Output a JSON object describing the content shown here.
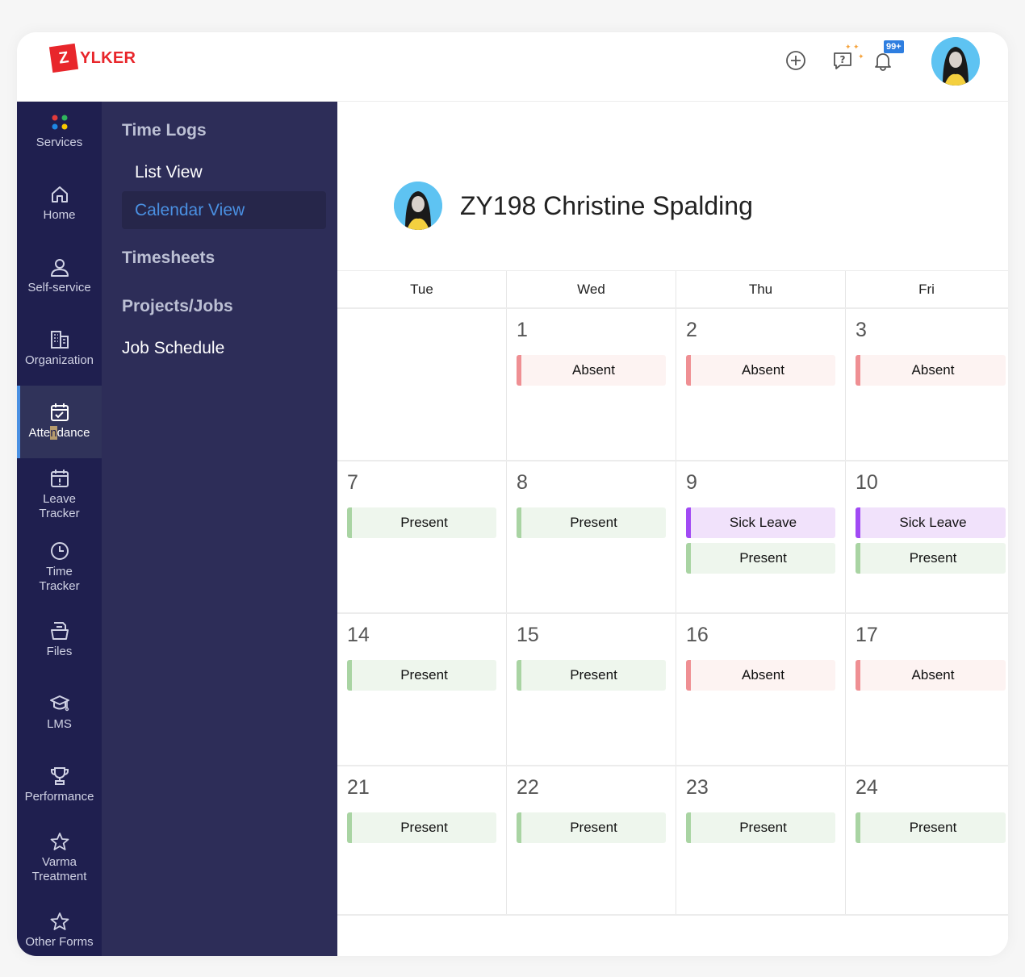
{
  "app": {
    "brand_letter": "Z",
    "brand_name": "YLKER",
    "accent": "#e8262b"
  },
  "header": {
    "icons": [
      "add-circle-icon",
      "help-chat-icon",
      "notification-bell-icon"
    ],
    "notification_badge": "99+"
  },
  "nav": {
    "items": [
      {
        "label": "Services",
        "icon": "services-dots-icon"
      },
      {
        "label": "Home",
        "icon": "home-icon"
      },
      {
        "label": "Self-service",
        "icon": "user-icon"
      },
      {
        "label": "Organization",
        "icon": "building-icon"
      },
      {
        "label_a": "Atte",
        "label_b": "n",
        "label_c": "dance",
        "icon": "calendar-check-icon",
        "active": true
      },
      {
        "label1": "Leave",
        "label2": "Tracker",
        "icon": "calendar-alert-icon"
      },
      {
        "label1": "Time",
        "label2": "Tracker",
        "icon": "clock-icon"
      },
      {
        "label": "Files",
        "icon": "folder-icon"
      },
      {
        "label": "LMS",
        "icon": "graduation-cap-icon"
      },
      {
        "label": "Performance",
        "icon": "trophy-icon"
      },
      {
        "label1": "Varma",
        "label2": "Treatment",
        "icon": "star-icon"
      },
      {
        "label": "Other Forms",
        "icon": "star-icon"
      }
    ]
  },
  "subnav": {
    "time_logs": "Time Logs",
    "list_view": "List View",
    "calendar_view": "Calendar View",
    "timesheets": "Timesheets",
    "projects_jobs": "Projects/Jobs",
    "job_schedule": "Job Schedule"
  },
  "employee": {
    "name": "ZY198 Christine Spalding"
  },
  "calendar": {
    "weekdays": [
      "Tue",
      "Wed",
      "Thu",
      "Fri"
    ],
    "weeks": [
      [
        {
          "day": "",
          "events": []
        },
        {
          "day": "1",
          "events": [
            {
              "label": "Absent",
              "type": "absent"
            }
          ]
        },
        {
          "day": "2",
          "events": [
            {
              "label": "Absent",
              "type": "absent"
            }
          ]
        },
        {
          "day": "3",
          "events": [
            {
              "label": "Absent",
              "type": "absent"
            }
          ]
        }
      ],
      [
        {
          "day": "7",
          "events": [
            {
              "label": "Present",
              "type": "present"
            }
          ]
        },
        {
          "day": "8",
          "events": [
            {
              "label": "Present",
              "type": "present"
            }
          ]
        },
        {
          "day": "9",
          "events": [
            {
              "label": "Sick Leave",
              "type": "sick"
            },
            {
              "label": "Present",
              "type": "present"
            }
          ]
        },
        {
          "day": "10",
          "events": [
            {
              "label": "Sick Leave",
              "type": "sick"
            },
            {
              "label": "Present",
              "type": "present"
            }
          ]
        }
      ],
      [
        {
          "day": "14",
          "events": [
            {
              "label": "Present",
              "type": "present"
            }
          ]
        },
        {
          "day": "15",
          "events": [
            {
              "label": "Present",
              "type": "present"
            }
          ]
        },
        {
          "day": "16",
          "events": [
            {
              "label": "Absent",
              "type": "absent"
            }
          ]
        },
        {
          "day": "17",
          "events": [
            {
              "label": "Absent",
              "type": "absent"
            }
          ]
        }
      ],
      [
        {
          "day": "21",
          "events": [
            {
              "label": "Present",
              "type": "present"
            }
          ]
        },
        {
          "day": "22",
          "events": [
            {
              "label": "Present",
              "type": "present"
            }
          ]
        },
        {
          "day": "23",
          "events": [
            {
              "label": "Present",
              "type": "present"
            }
          ]
        },
        {
          "day": "24",
          "events": [
            {
              "label": "Present",
              "type": "present"
            }
          ]
        }
      ]
    ],
    "colors": {
      "absent": "#ef8f93",
      "present": "#a9d4a3",
      "sick": "#a14af4"
    }
  }
}
